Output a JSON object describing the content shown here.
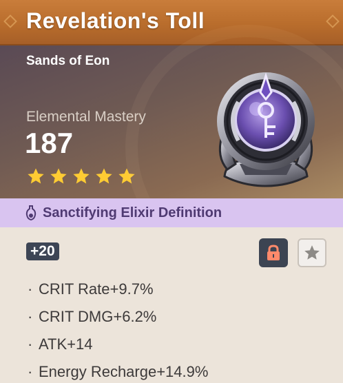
{
  "artifact": {
    "name": "Revelation's Toll",
    "slot": "Sands of Eon",
    "main_stat": {
      "name": "Elemental Mastery",
      "value": "187"
    },
    "rarity": 5,
    "level": "+20",
    "set_name": "Sanctifying Elixir Definition",
    "substats": [
      {
        "bullet": "·",
        "text": "CRIT Rate+9.7%"
      },
      {
        "bullet": "·",
        "text": "CRIT DMG+6.2%"
      },
      {
        "bullet": "·",
        "text": "ATK+14"
      },
      {
        "bullet": "·",
        "text": "Energy Recharge+14.9%"
      }
    ]
  },
  "icons": {
    "lock": "lock-icon",
    "favorite": "star-icon",
    "set": "elixir-flask-icon",
    "rarity_star": "star-icon"
  },
  "colors": {
    "title_bar": "#b96d2c",
    "set_bar": "#d9c4f0",
    "set_text": "#4f3a72",
    "star": "#ffcc33",
    "lock_bg": "#3c4452",
    "lock_icon": "#ff8a6b",
    "body_bg": "#ece4da"
  }
}
